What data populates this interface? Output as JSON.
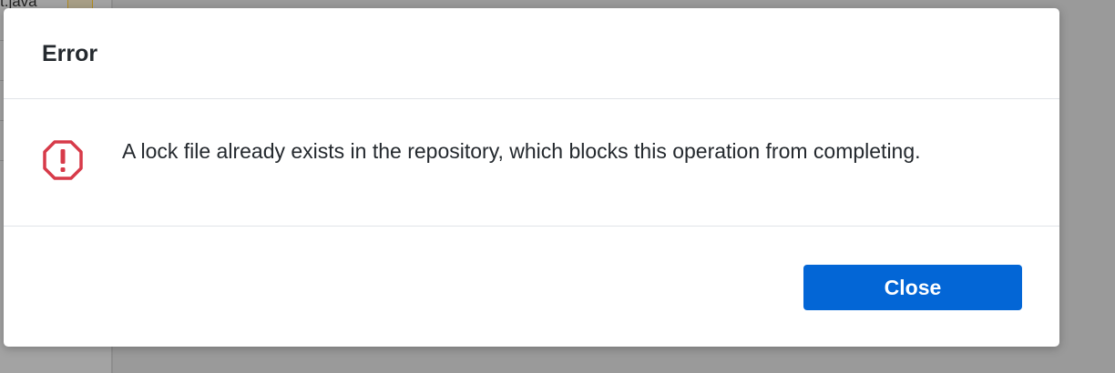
{
  "background": {
    "filename": "t.java"
  },
  "dialog": {
    "title": "Error",
    "icon": "stop-octagon-alert-icon",
    "message": "A lock file already exists in the repository, which blocks this operation from completing.",
    "close_label": "Close",
    "colors": {
      "error_icon": "#d73a49",
      "button": "#0366d6",
      "text": "#24292e"
    }
  }
}
